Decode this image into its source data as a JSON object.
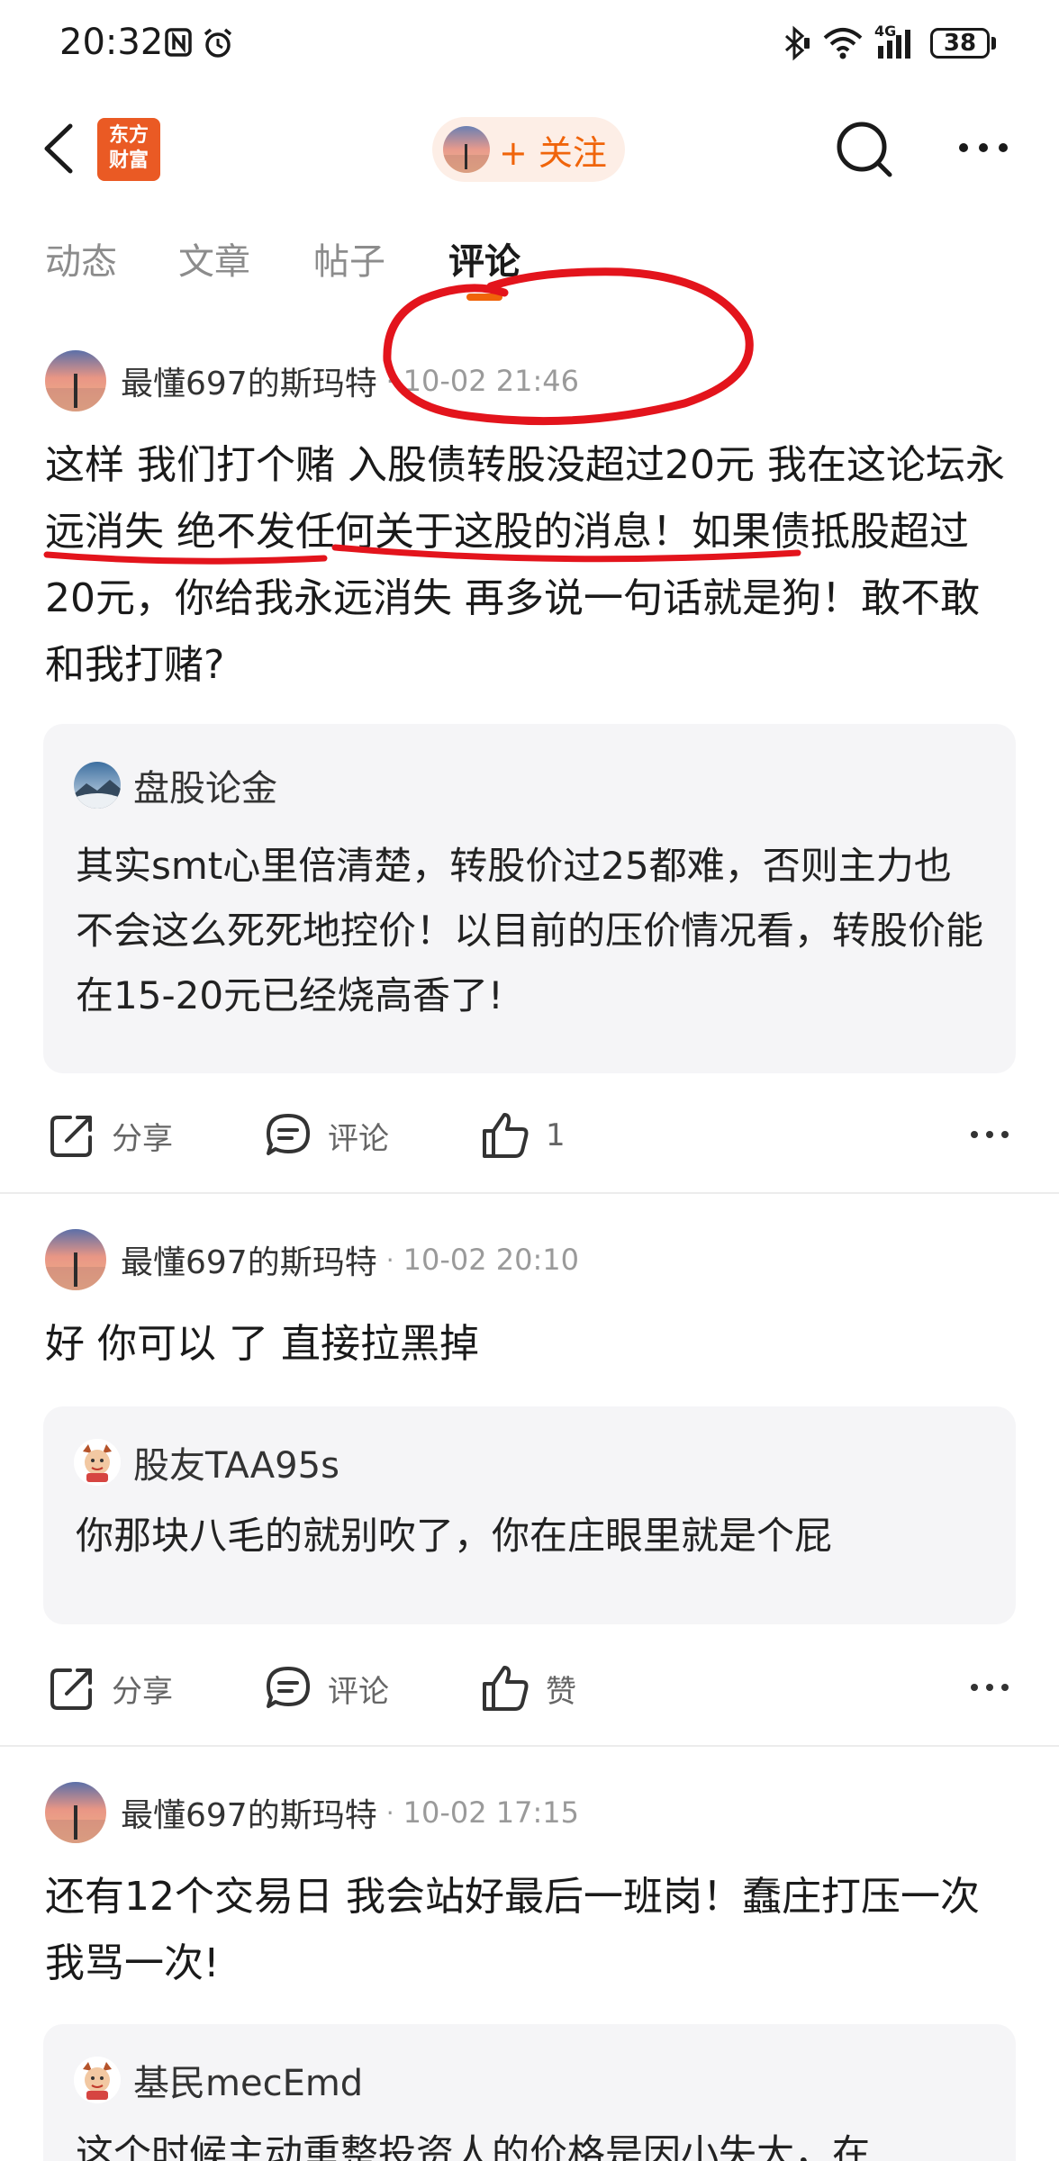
{
  "status_bar": {
    "time": "20:32",
    "network": "4G",
    "battery": "38"
  },
  "header": {
    "logo_text_line1": "东方",
    "logo_text_line2": "财富",
    "follow_label": "+ 关注"
  },
  "tabs": [
    {
      "label": "动态",
      "active": false
    },
    {
      "label": "文章",
      "active": false
    },
    {
      "label": "帖子",
      "active": false
    },
    {
      "label": "评论",
      "active": true
    }
  ],
  "posts": [
    {
      "author": "最懂697的斯玛特",
      "time": "10-02 21:46",
      "body": "这样 我们打个赌 入股债转股没超过20元 我在这论坛永远消失 绝不发任何关于这股的消息！如果债抵股超过20元，你给我永远消失 再多说一句话就是狗！敢不敢和我打赌?",
      "quote_author": "盘股论金",
      "quote_text": "其实smt心里倍清楚，转股价过25都难，否则主力也不会这么死死地控价！以目前的压价情况看，转股价能在15-20元已经烧高香了!",
      "share_label": "分享",
      "comment_label": "评论",
      "like_label": "1"
    },
    {
      "author": "最懂697的斯玛特",
      "time": "10-02 20:10",
      "body": "好 你可以 了 直接拉黑掉",
      "quote_author": "股友TAA95s",
      "quote_text": "你那块八毛的就别吹了，你在庄眼里就是个屁",
      "share_label": "分享",
      "comment_label": "评论",
      "like_label": "赞"
    },
    {
      "author": "最懂697的斯玛特",
      "time": "10-02 17:15",
      "body": "还有12个交易日 我会站好最后一班岗！蠢庄打压一次 我骂一次!",
      "quote_author": "基民mecEmd",
      "quote_text": "这个时候主动重整投资人的价格是因小失大，在"
    }
  ],
  "colors": {
    "accent": "#f0640a",
    "logo": "#ea5a24",
    "annotation": "#e3141c",
    "card_bg": "#f5f5f7"
  }
}
